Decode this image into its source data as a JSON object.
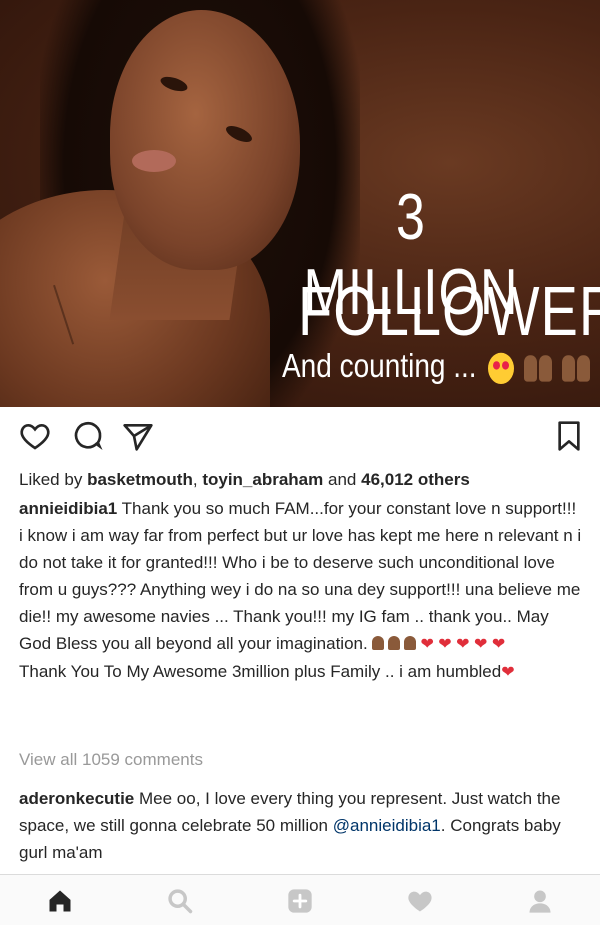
{
  "post_image": {
    "headline_line1": "3 MILLION",
    "headline_line2": "FOLLOWERS",
    "subline": "And counting ...",
    "emoji": [
      "heart-eyes-emoji",
      "raised-hands-emoji",
      "raised-hands-emoji"
    ]
  },
  "actions": {
    "like_icon": "heart-outline-icon",
    "comment_icon": "comment-bubble-icon",
    "share_icon": "paper-plane-icon",
    "save_icon": "bookmark-icon"
  },
  "likes": {
    "prefix": "Liked by",
    "user1": "basketmouth",
    "separator": ",",
    "user2": "toyin_abraham",
    "and": "and",
    "count": "46,012 others"
  },
  "caption": {
    "username": "annieidibia1",
    "text": "Thank you so much FAM...for your constant love n support!!! i know i am way far from perfect but ur love has kept me here n relevant n i do not take it for granted!!! Who i be to deserve such unconditional love from u guys??? Anything wey i do na so una dey support!!! una believe me die!! my awesome navies ... Thank you!!! my IG fam .. thank you.. May God Bless you all beyond all your imagination.",
    "text2": "Thank You To My Awesome 3million  plus Family .. i am humbled"
  },
  "view_all_comments": "View all 1059 comments",
  "comment": {
    "username": "aderonkecutie",
    "text": "Mee oo, I love every thing you represent. Just watch the space, we still gonna celebrate 50 million",
    "mention": "@annieidibia1",
    "text_after": ". Congrats baby gurl ma'am"
  },
  "bottom_nav": {
    "items": [
      "home-icon",
      "search-icon",
      "add-post-icon",
      "activity-heart-icon",
      "profile-icon"
    ],
    "active": "home-icon"
  },
  "colors": {
    "text": "#262626",
    "muted": "#999999",
    "heart_red": "#e02e3a",
    "nav_bg": "#fafafa"
  }
}
